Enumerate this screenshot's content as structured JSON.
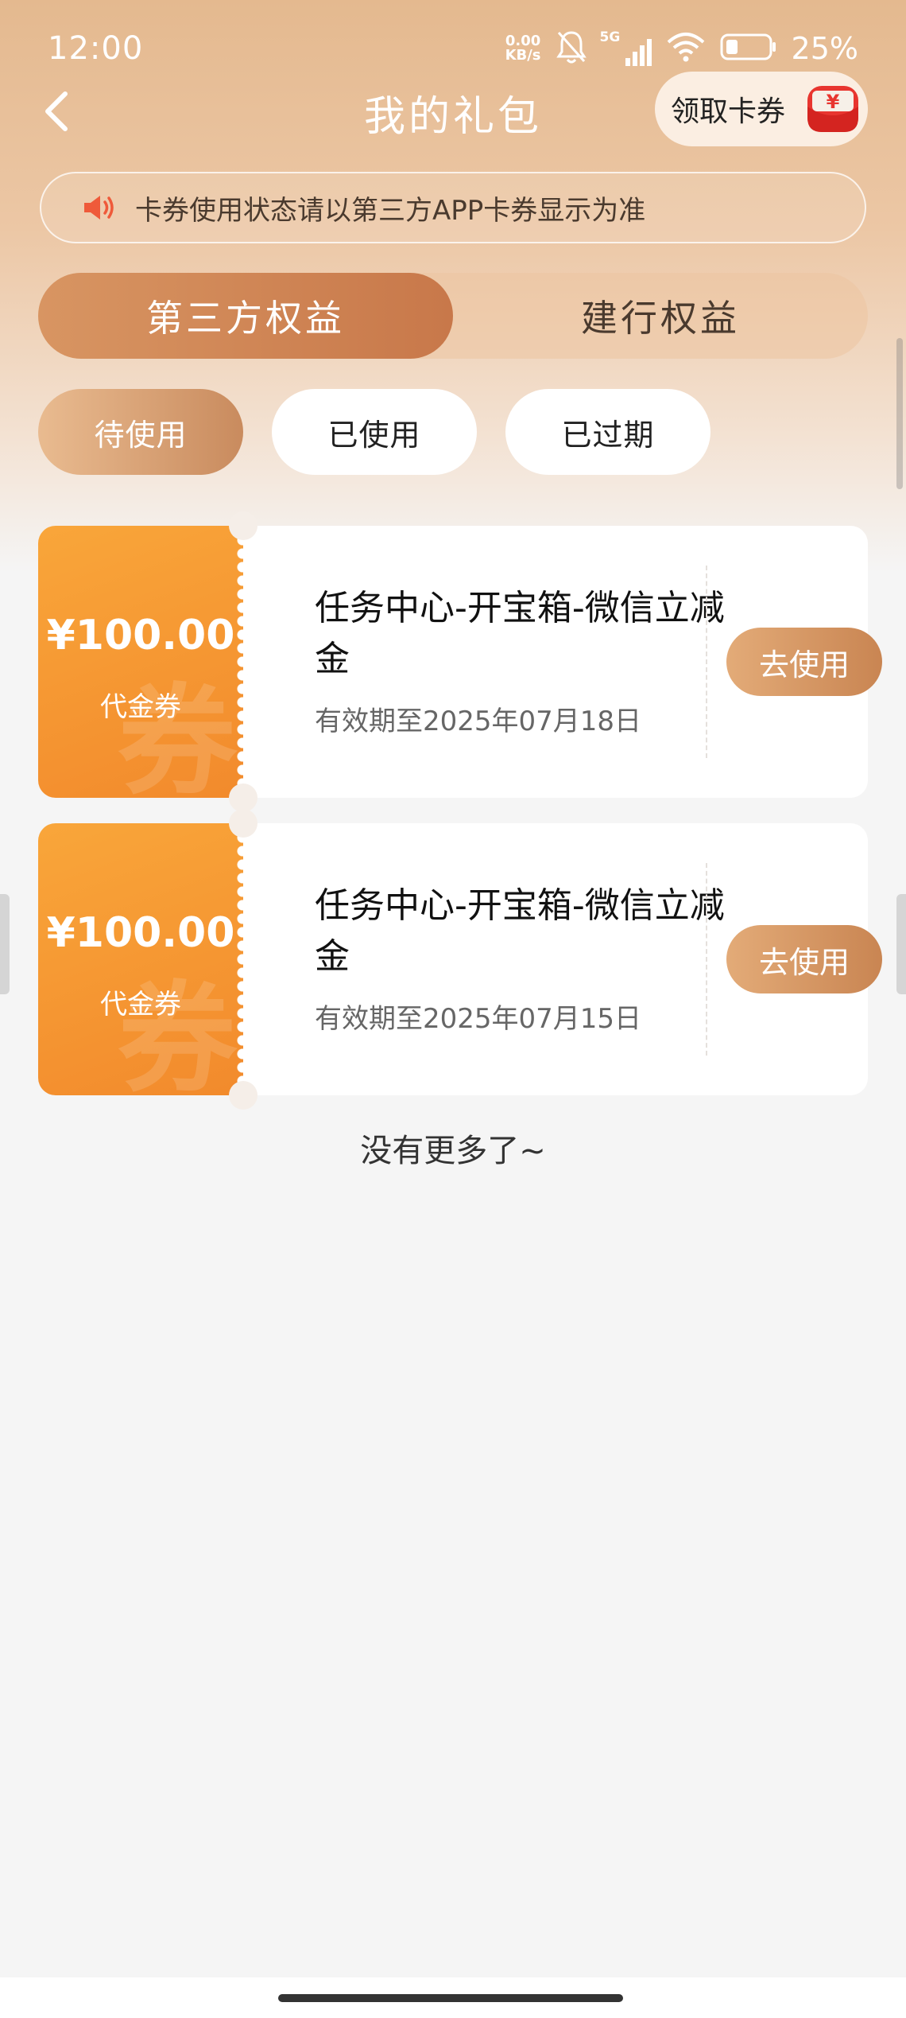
{
  "status_bar": {
    "time": "12:00",
    "net_speed_value": "0.00",
    "net_speed_unit": "KB/s",
    "network_type": "5G",
    "battery_percent": "25%",
    "icons": [
      "mute-icon",
      "signal-icon",
      "wifi-icon",
      "battery-icon"
    ]
  },
  "nav": {
    "title": "我的礼包",
    "claim_button_label": "领取卡券",
    "claim_icon_symbol": "¥"
  },
  "notice": {
    "text": "卡券使用状态请以第三方APP卡券显示为准"
  },
  "main_tabs": [
    {
      "label": "第三方权益",
      "active": true
    },
    {
      "label": "建行权益",
      "active": false
    }
  ],
  "sub_tabs": [
    {
      "label": "待使用",
      "active": true
    },
    {
      "label": "已使用",
      "active": false
    },
    {
      "label": "已过期",
      "active": false
    }
  ],
  "coupons": [
    {
      "amount": "¥100.00",
      "type": "代金券",
      "watermark": "券",
      "name": "任务中心-开宝箱-微信立减金",
      "expiry": "有效期至2025年07月18日",
      "action_label": "去使用"
    },
    {
      "amount": "¥100.00",
      "type": "代金券",
      "watermark": "券",
      "name": "任务中心-开宝箱-微信立减金",
      "expiry": "有效期至2025年07月15日",
      "action_label": "去使用"
    }
  ],
  "list_footer": {
    "text": "没有更多了~"
  },
  "colors": {
    "accent": "#c8784a",
    "coupon_orange": "#f28a2c",
    "header_bg": "#e4b98f"
  }
}
